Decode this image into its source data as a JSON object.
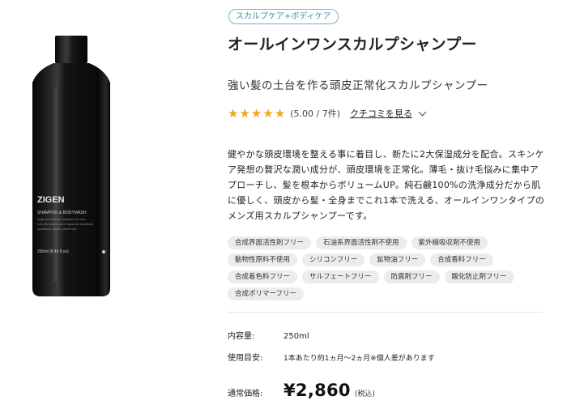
{
  "product": {
    "category_badge": "スカルプケア+ボディケア",
    "title": "オールインワンスカルプシャンプー",
    "catchcopy": "強い髪の土台を作る頭皮正常化スカルプシャンプー",
    "rating": {
      "stars": 5,
      "text": "(5.00 / 7件)",
      "review_link": "クチコミを見る"
    },
    "description": "健やかな頭皮環境を整える事に着目し、新たに2大保湿成分を配合。スキンケア発想の贅沢な潤い成分が、頭皮環境を正常化。薄毛・抜け毛悩みに集中アプローチし、髪を根本からボリュームUP。純石鹸100%の洗浄成分だから肌に優しく、頭皮から髪・全身までこれ1本で洗える、オールインワンタイプのメンズ用スカルプシャンプーです。",
    "tags": [
      [
        "合成界面活性剤フリー",
        "石油系界面活性剤不使用",
        "紫外線吸収剤不使用"
      ],
      [
        "動物性原料不使用",
        "シリコンフリー",
        "鉱物油フリー",
        "合成香料フリー"
      ],
      [
        "合成着色料フリー",
        "サルフェートフリー",
        "防腐剤フリー",
        "酸化防止剤フリー"
      ],
      [
        "合成ポリマーフリー"
      ]
    ],
    "specs": {
      "capacity_label": "内容量:",
      "capacity_value": "250ml",
      "usage_label": "使用目安:",
      "usage_value": "1本あたり約1ヵ月〜2ヵ月※個人差があります"
    },
    "price": {
      "label": "通常価格:",
      "value": "¥2,860",
      "tax_note": "(税込)"
    },
    "bottle": {
      "brand": "ZIGEN",
      "line1": "SHAMPOO & BODYWASH",
      "line2": "scalp sensitive skin shampoo for men",
      "line3": "Lets the brown cost of Japanese botanicals",
      "line4": "conditioner, gentle, sweet herb",
      "volume": "250ml (8.45 fl.oz)"
    }
  },
  "colors": {
    "star": "#f0a818",
    "badge_border": "#6bb8c8",
    "badge_text": "#3e8fa2",
    "tag_bg": "#ececec"
  }
}
